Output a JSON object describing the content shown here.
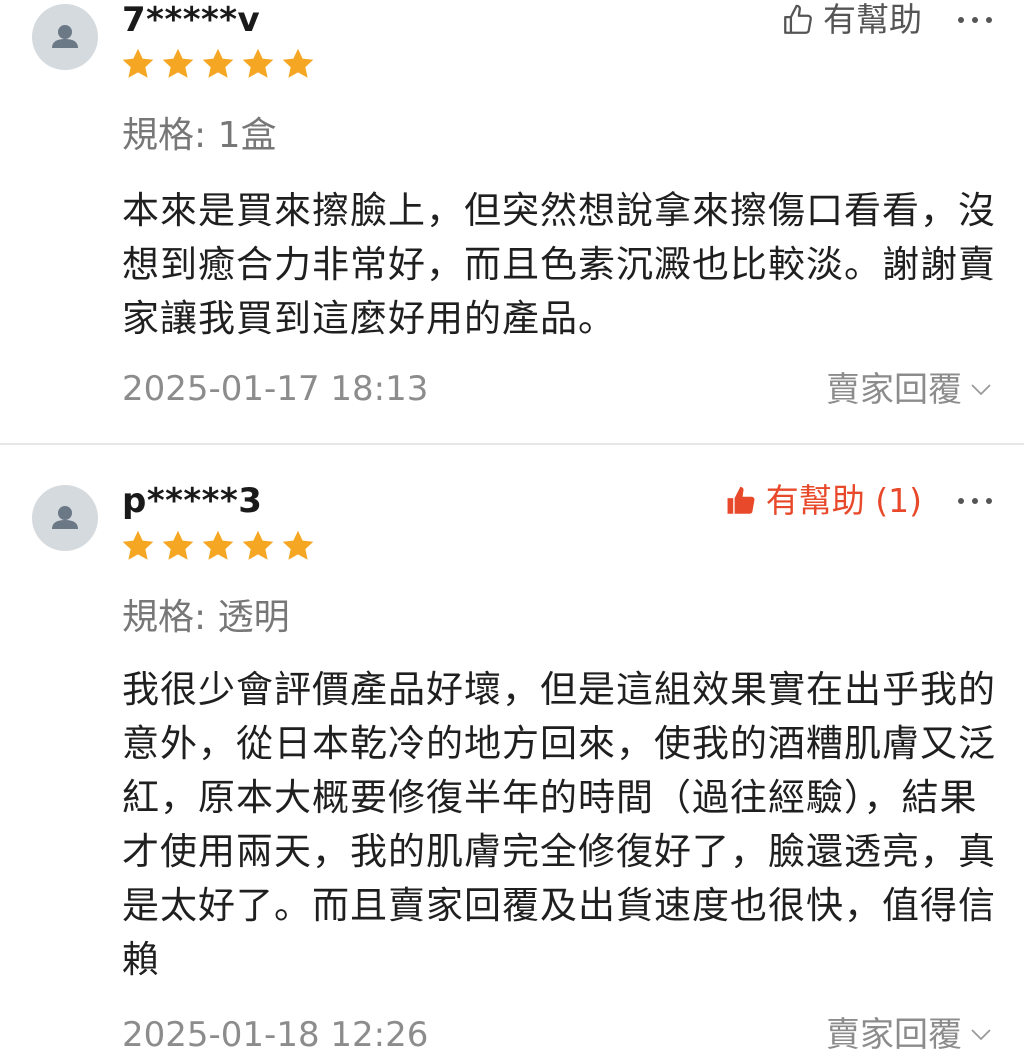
{
  "reviews": [
    {
      "username": "7*****v",
      "rating": 5,
      "helpful_label": "有幫助",
      "helpful_active": false,
      "spec": "規格: 1盒",
      "content": "本來是買來擦臉上，但突然想說拿來擦傷口看看，沒想到癒合力非常好，而且色素沉澱也比較淡。謝謝賣家讓我買到這麼好用的產品。",
      "time": "2025-01-17 18:13",
      "seller_reply_label": "賣家回覆"
    },
    {
      "username": "p*****3",
      "rating": 5,
      "helpful_label": "有幫助 (1)",
      "helpful_active": true,
      "spec": "規格: 透明",
      "content": "我很少會評價產品好壞，但是這組效果實在出乎我的意外，從日本乾冷的地方回來，使我的酒糟肌膚又泛紅，原本大概要修復半年的時間（過往經驗），結果才使用兩天，我的肌膚完全修復好了，臉還透亮，真是太好了。而且賣家回覆及出貨速度也很快，值得信賴",
      "time": "2025-01-18 12:26",
      "seller_reply_label": "賣家回覆"
    }
  ],
  "colors": {
    "star": "#f5a623",
    "accent": "#e8492b",
    "muted": "#8c8c8c",
    "avatar_bg": "#d5dade"
  },
  "icons": {
    "avatar": "user-avatar-icon",
    "rating": "star-icon",
    "helpful_inactive": "thumbs-up-outline-icon",
    "helpful_active": "thumbs-up-filled-icon",
    "more": "more-dots-icon",
    "expand": "chevron-down-icon"
  }
}
